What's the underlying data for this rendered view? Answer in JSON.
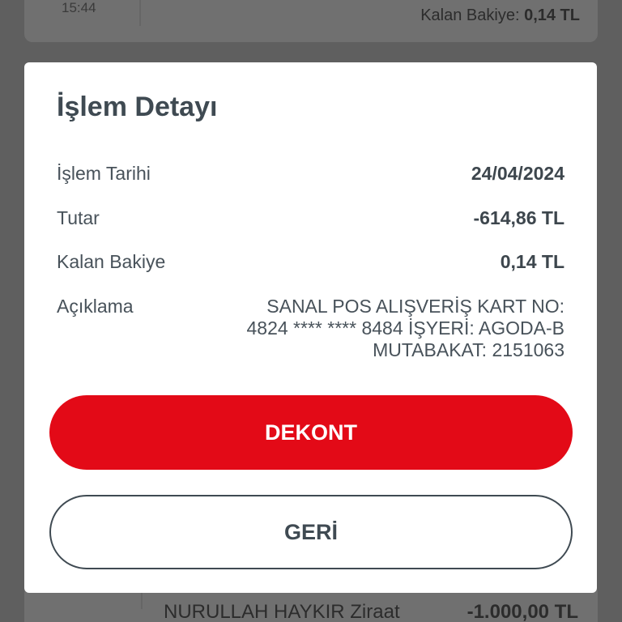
{
  "background": {
    "top_item": {
      "time": "15:44",
      "balance_label": "Kalan Bakiye:",
      "balance_value": "0,14 TL"
    },
    "bottom_item": {
      "name": "NURULLAH HAYKIR Ziraat",
      "amount": "-1.000,00 TL"
    }
  },
  "modal": {
    "title": "İşlem Detayı",
    "rows": {
      "date": {
        "label": "İşlem Tarihi",
        "value": "24/04/2024"
      },
      "amount": {
        "label": "Tutar",
        "value": "-614,86 TL"
      },
      "balance": {
        "label": "Kalan Bakiye",
        "value": "0,14 TL"
      },
      "description": {
        "label": "Açıklama",
        "lines": [
          "SANAL POS ALIŞVERİŞ KART NO:",
          "4824 **** **** 8484 İŞYERİ: AGODA-B",
          "MUTABAKAT: 2151063"
        ]
      }
    },
    "buttons": {
      "receipt": "DEKONT",
      "back": "GERİ"
    }
  },
  "colors": {
    "primary_red": "#e30a17",
    "text_dark": "#3f4a52",
    "overlay": "#5f5f5f"
  }
}
